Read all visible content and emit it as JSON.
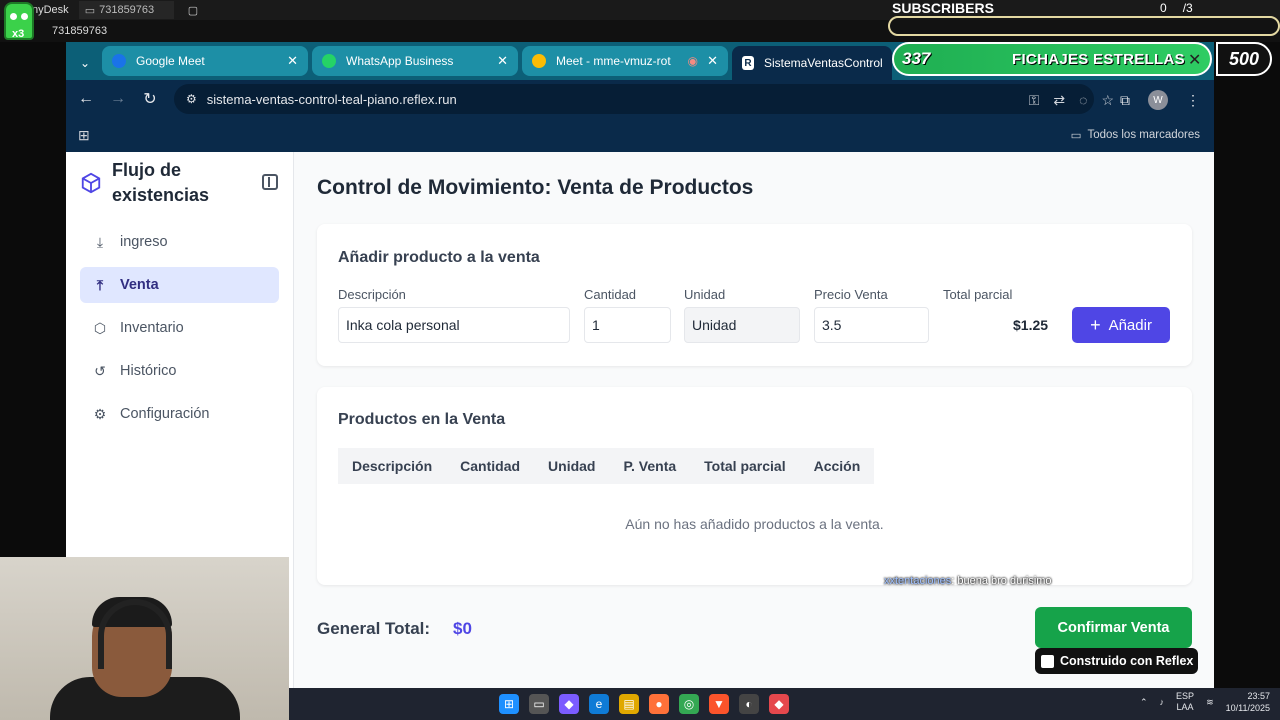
{
  "anydesk": {
    "brand": "nyDesk",
    "tab_id": "731859763",
    "session_id": "731859763",
    "mascot_badge": "x3"
  },
  "overlay": {
    "subscribers_label": "SUBSCRIBERS",
    "subs_counts": [
      "0",
      "/3"
    ],
    "fichajes_count": "337",
    "fichajes_title": "FICHAJES ESTRELLAS",
    "fichajes_goal": "500",
    "chat_user": "xxtentaciones",
    "chat_message": ": buena bro durisimo"
  },
  "browser": {
    "tabs": [
      {
        "title": "Google Meet",
        "color": "#1a73e8"
      },
      {
        "title": "WhatsApp Business",
        "color": "#25d366"
      },
      {
        "title": "Meet - mme-vmuz-rot",
        "color": "#fbbc04"
      },
      {
        "title": "SistemaVentasControl | In",
        "active": true,
        "fav": "R"
      }
    ],
    "url": "sistema-ventas-control-teal-piano.reflex.run",
    "profile_initial": "W",
    "bookmarks_label": "Todos los marcadores"
  },
  "sidebar": {
    "title": "Flujo de existencias",
    "items": [
      {
        "label": "ingreso",
        "icon": "download-icon",
        "glyph": "⤓"
      },
      {
        "label": "Venta",
        "icon": "upload-icon",
        "glyph": "⤒",
        "active": true
      },
      {
        "label": "Inventario",
        "icon": "boxes-icon",
        "glyph": "⬡"
      },
      {
        "label": "Histórico",
        "icon": "history-icon",
        "glyph": "↺"
      },
      {
        "label": "Configuración",
        "icon": "gear-icon",
        "glyph": "⚙"
      }
    ]
  },
  "main": {
    "title": "Control de Movimiento: Venta de Productos",
    "add_card": {
      "title": "Añadir producto a la venta",
      "labels": {
        "descripcion": "Descripción",
        "cantidad": "Cantidad",
        "unidad": "Unidad",
        "precio": "Precio Venta",
        "total": "Total parcial"
      },
      "values": {
        "descripcion": "Inka cola personal",
        "cantidad": "1",
        "unidad": "Unidad",
        "precio": "3.5"
      },
      "partial_total": "$1.25",
      "add_button": "Añadir"
    },
    "products_card": {
      "title": "Productos en la Venta",
      "columns": [
        "Descripción",
        "Cantidad",
        "Unidad",
        "P. Venta",
        "Total parcial",
        "Acción"
      ],
      "empty_message": "Aún no has añadido productos a la venta."
    },
    "grand_total_label": "General Total:",
    "grand_total_value": "$0",
    "confirm_button": "Confirmar Venta",
    "reflex_badge": "Construido con Reflex"
  },
  "taskbar": {
    "lang_top": "ESP",
    "lang_bottom": "LAA",
    "time": "23:57",
    "date": "10/11/2025"
  }
}
